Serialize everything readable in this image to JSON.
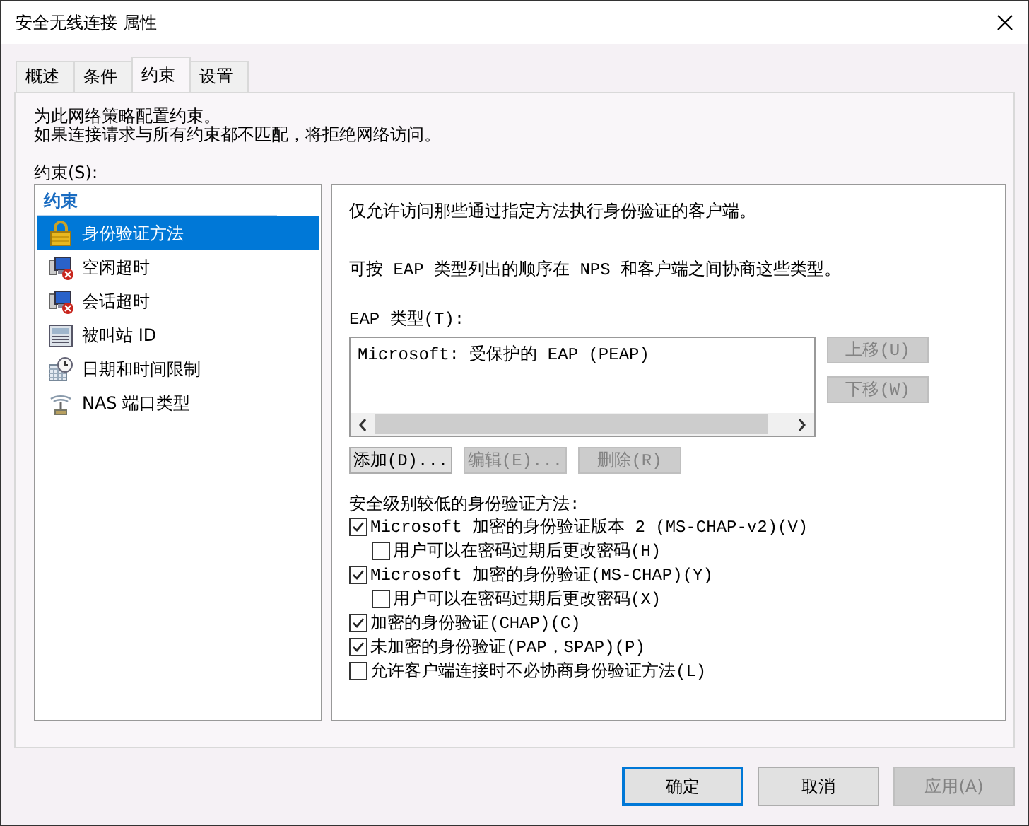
{
  "window": {
    "title": "安全无线连接 属性"
  },
  "tabs": [
    {
      "label": "概述",
      "selected": false
    },
    {
      "label": "条件",
      "selected": false
    },
    {
      "label": "约束",
      "selected": true
    },
    {
      "label": "设置",
      "selected": false
    }
  ],
  "intro": [
    "为此网络策略配置约束。",
    "如果连接请求与所有约束都不匹配，将拒绝网络访问。"
  ],
  "constraints_label": "约束(S):",
  "constraints": {
    "heading": "约束",
    "items": [
      {
        "label": "身份验证方法",
        "kind": "lock",
        "selected": true
      },
      {
        "label": "空闲超时",
        "kind": "monitor",
        "selected": false
      },
      {
        "label": "会话超时",
        "kind": "monitor",
        "selected": false
      },
      {
        "label": "被叫站 ID",
        "kind": "phone",
        "selected": false
      },
      {
        "label": "日期和时间限制",
        "kind": "calendar",
        "selected": false
      },
      {
        "label": "NAS 端口类型",
        "kind": "antenna",
        "selected": false
      }
    ]
  },
  "detail": {
    "description": "仅允许访问那些通过指定方法执行身份验证的客户端。",
    "order_note": "可按 EAP 类型列出的顺序在 NPS 和客户端之间协商这些类型。",
    "eap_label": "EAP 类型(T):",
    "eap_types": [
      "Microsoft: 受保护的 EAP (PEAP)"
    ],
    "side_buttons": [
      {
        "label": "上移(U)",
        "disabled": true
      },
      {
        "label": "下移(W)",
        "disabled": true
      }
    ],
    "list_buttons": [
      {
        "label": "添加(D)...",
        "disabled": false
      },
      {
        "label": "编辑(E)...",
        "disabled": true
      },
      {
        "label": "删除(R)",
        "disabled": true
      }
    ],
    "less_secure_label": "安全级别较低的身份验证方法:",
    "methods": [
      {
        "label": "Microsoft 加密的身份验证版本 2 (MS-CHAP-v2)(V)",
        "checked": true,
        "children": [
          {
            "label": "用户可以在密码过期后更改密码(H)",
            "checked": false
          }
        ]
      },
      {
        "label": "Microsoft 加密的身份验证(MS-CHAP)(Y)",
        "checked": true,
        "children": [
          {
            "label": "用户可以在密码过期后更改密码(X)",
            "checked": false
          }
        ]
      },
      {
        "label": "加密的身份验证(CHAP)(C)",
        "checked": true
      },
      {
        "label": "未加密的身份验证(PAP，SPAP)(P)",
        "checked": true
      },
      {
        "label": "允许客户端连接时不必协商身份验证方法(L)",
        "checked": false
      }
    ]
  },
  "buttons": [
    {
      "label": "确定",
      "default": true,
      "disabled": false
    },
    {
      "label": "取消",
      "default": false,
      "disabled": false
    },
    {
      "label": "应用(A)",
      "default": false,
      "disabled": true
    }
  ]
}
